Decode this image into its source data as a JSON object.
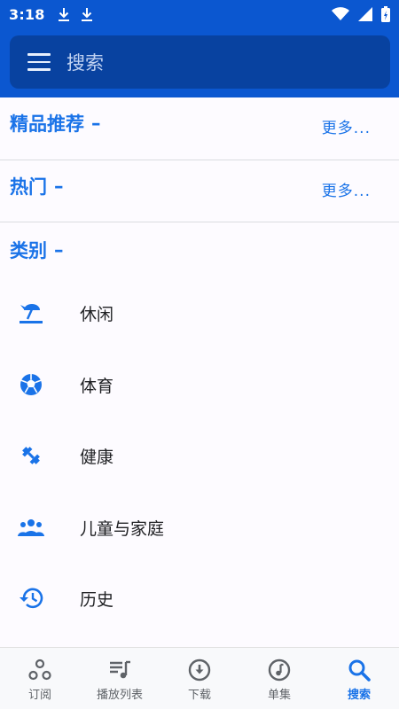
{
  "status_bar": {
    "time": "3:18"
  },
  "search": {
    "placeholder": "搜索"
  },
  "sections": {
    "featured": {
      "title": "精品推荐",
      "dash": "–",
      "more": "更多..."
    },
    "popular": {
      "title": "热门",
      "dash": "–",
      "more": "更多..."
    },
    "categories": {
      "title": "类别",
      "dash": "–"
    }
  },
  "category_items": [
    {
      "label": "休闲",
      "icon": "beach-umbrella-icon"
    },
    {
      "label": "体育",
      "icon": "soccer-ball-icon"
    },
    {
      "label": "健康",
      "icon": "dumbbell-icon"
    },
    {
      "label": "儿童与家庭",
      "icon": "family-group-icon"
    },
    {
      "label": "历史",
      "icon": "history-clock-icon"
    }
  ],
  "bottom_nav": [
    {
      "label": "订阅",
      "icon": "subscriptions-icon"
    },
    {
      "label": "播放列表",
      "icon": "playlist-icon"
    },
    {
      "label": "下载",
      "icon": "download-icon"
    },
    {
      "label": "单集",
      "icon": "music-note-icon"
    },
    {
      "label": "搜索",
      "icon": "search-icon",
      "active": true
    }
  ],
  "colors": {
    "primary": "#0b57d0",
    "accent": "#1a73e8",
    "search_box": "#0842a0"
  }
}
